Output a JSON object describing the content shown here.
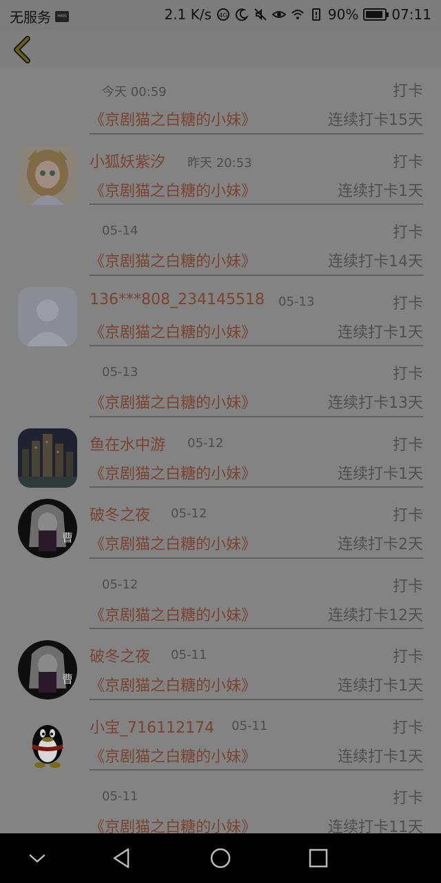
{
  "status_bar": {
    "carrier": "无服务",
    "speed": "2.1 K/s",
    "battery": "90%",
    "battery_level": 0.9,
    "time": "07:11"
  },
  "header": {
    "back_icon": "chevron-left-icon",
    "accent_color": "#6b6013"
  },
  "entries": [
    {
      "user": "",
      "time": "今天 00:59",
      "action": "打卡",
      "book": "《京剧猫之白糖的小妹》",
      "streak": "连续打卡15天",
      "avatar": "none"
    },
    {
      "user": "小狐妖紫汐",
      "time": "昨天 20:53",
      "action": "打卡",
      "book": "《京剧猫之白糖的小妹》",
      "streak": "连续打卡1天",
      "avatar": "anime-girl"
    },
    {
      "user": "",
      "time": "05-14",
      "action": "打卡",
      "book": "《京剧猫之白糖的小妹》",
      "streak": "连续打卡14天",
      "avatar": "none"
    },
    {
      "user": "136***808_234145518",
      "time": "05-13",
      "action": "打卡",
      "book": "《京剧猫之白糖的小妹》",
      "streak": "连续打卡1天",
      "avatar": "default-person"
    },
    {
      "user": "",
      "time": "05-13",
      "action": "打卡",
      "book": "《京剧猫之白糖的小妹》",
      "streak": "连续打卡13天",
      "avatar": "none"
    },
    {
      "user": "鱼在水中游",
      "time": "05-12",
      "action": "打卡",
      "book": "《京剧猫之白糖的小妹》",
      "streak": "连续打卡1天",
      "avatar": "city-night"
    },
    {
      "user": "破冬之夜",
      "time": "05-12",
      "action": "打卡",
      "book": "《京剧猫之白糖的小妹》",
      "streak": "连续打卡2天",
      "avatar": "dark-anime"
    },
    {
      "user": "",
      "time": "05-12",
      "action": "打卡",
      "book": "《京剧猫之白糖的小妹》",
      "streak": "连续打卡12天",
      "avatar": "none"
    },
    {
      "user": "破冬之夜",
      "time": "05-11",
      "action": "打卡",
      "book": "《京剧猫之白糖的小妹》",
      "streak": "连续打卡1天",
      "avatar": "dark-anime"
    },
    {
      "user": "小宝_716112174",
      "time": "05-11",
      "action": "打卡",
      "book": "《京剧猫之白糖的小妹》",
      "streak": "连续打卡1天",
      "avatar": "qq-penguin"
    },
    {
      "user": "",
      "time": "05-11",
      "action": "打卡",
      "book": "《京剧猫之白糖的小妹》",
      "streak": "连续打卡11天",
      "avatar": "none"
    }
  ],
  "nav_bar": {
    "icons": [
      "chevron-down-icon",
      "back-triangle-icon",
      "home-circle-icon",
      "recents-square-icon"
    ]
  }
}
